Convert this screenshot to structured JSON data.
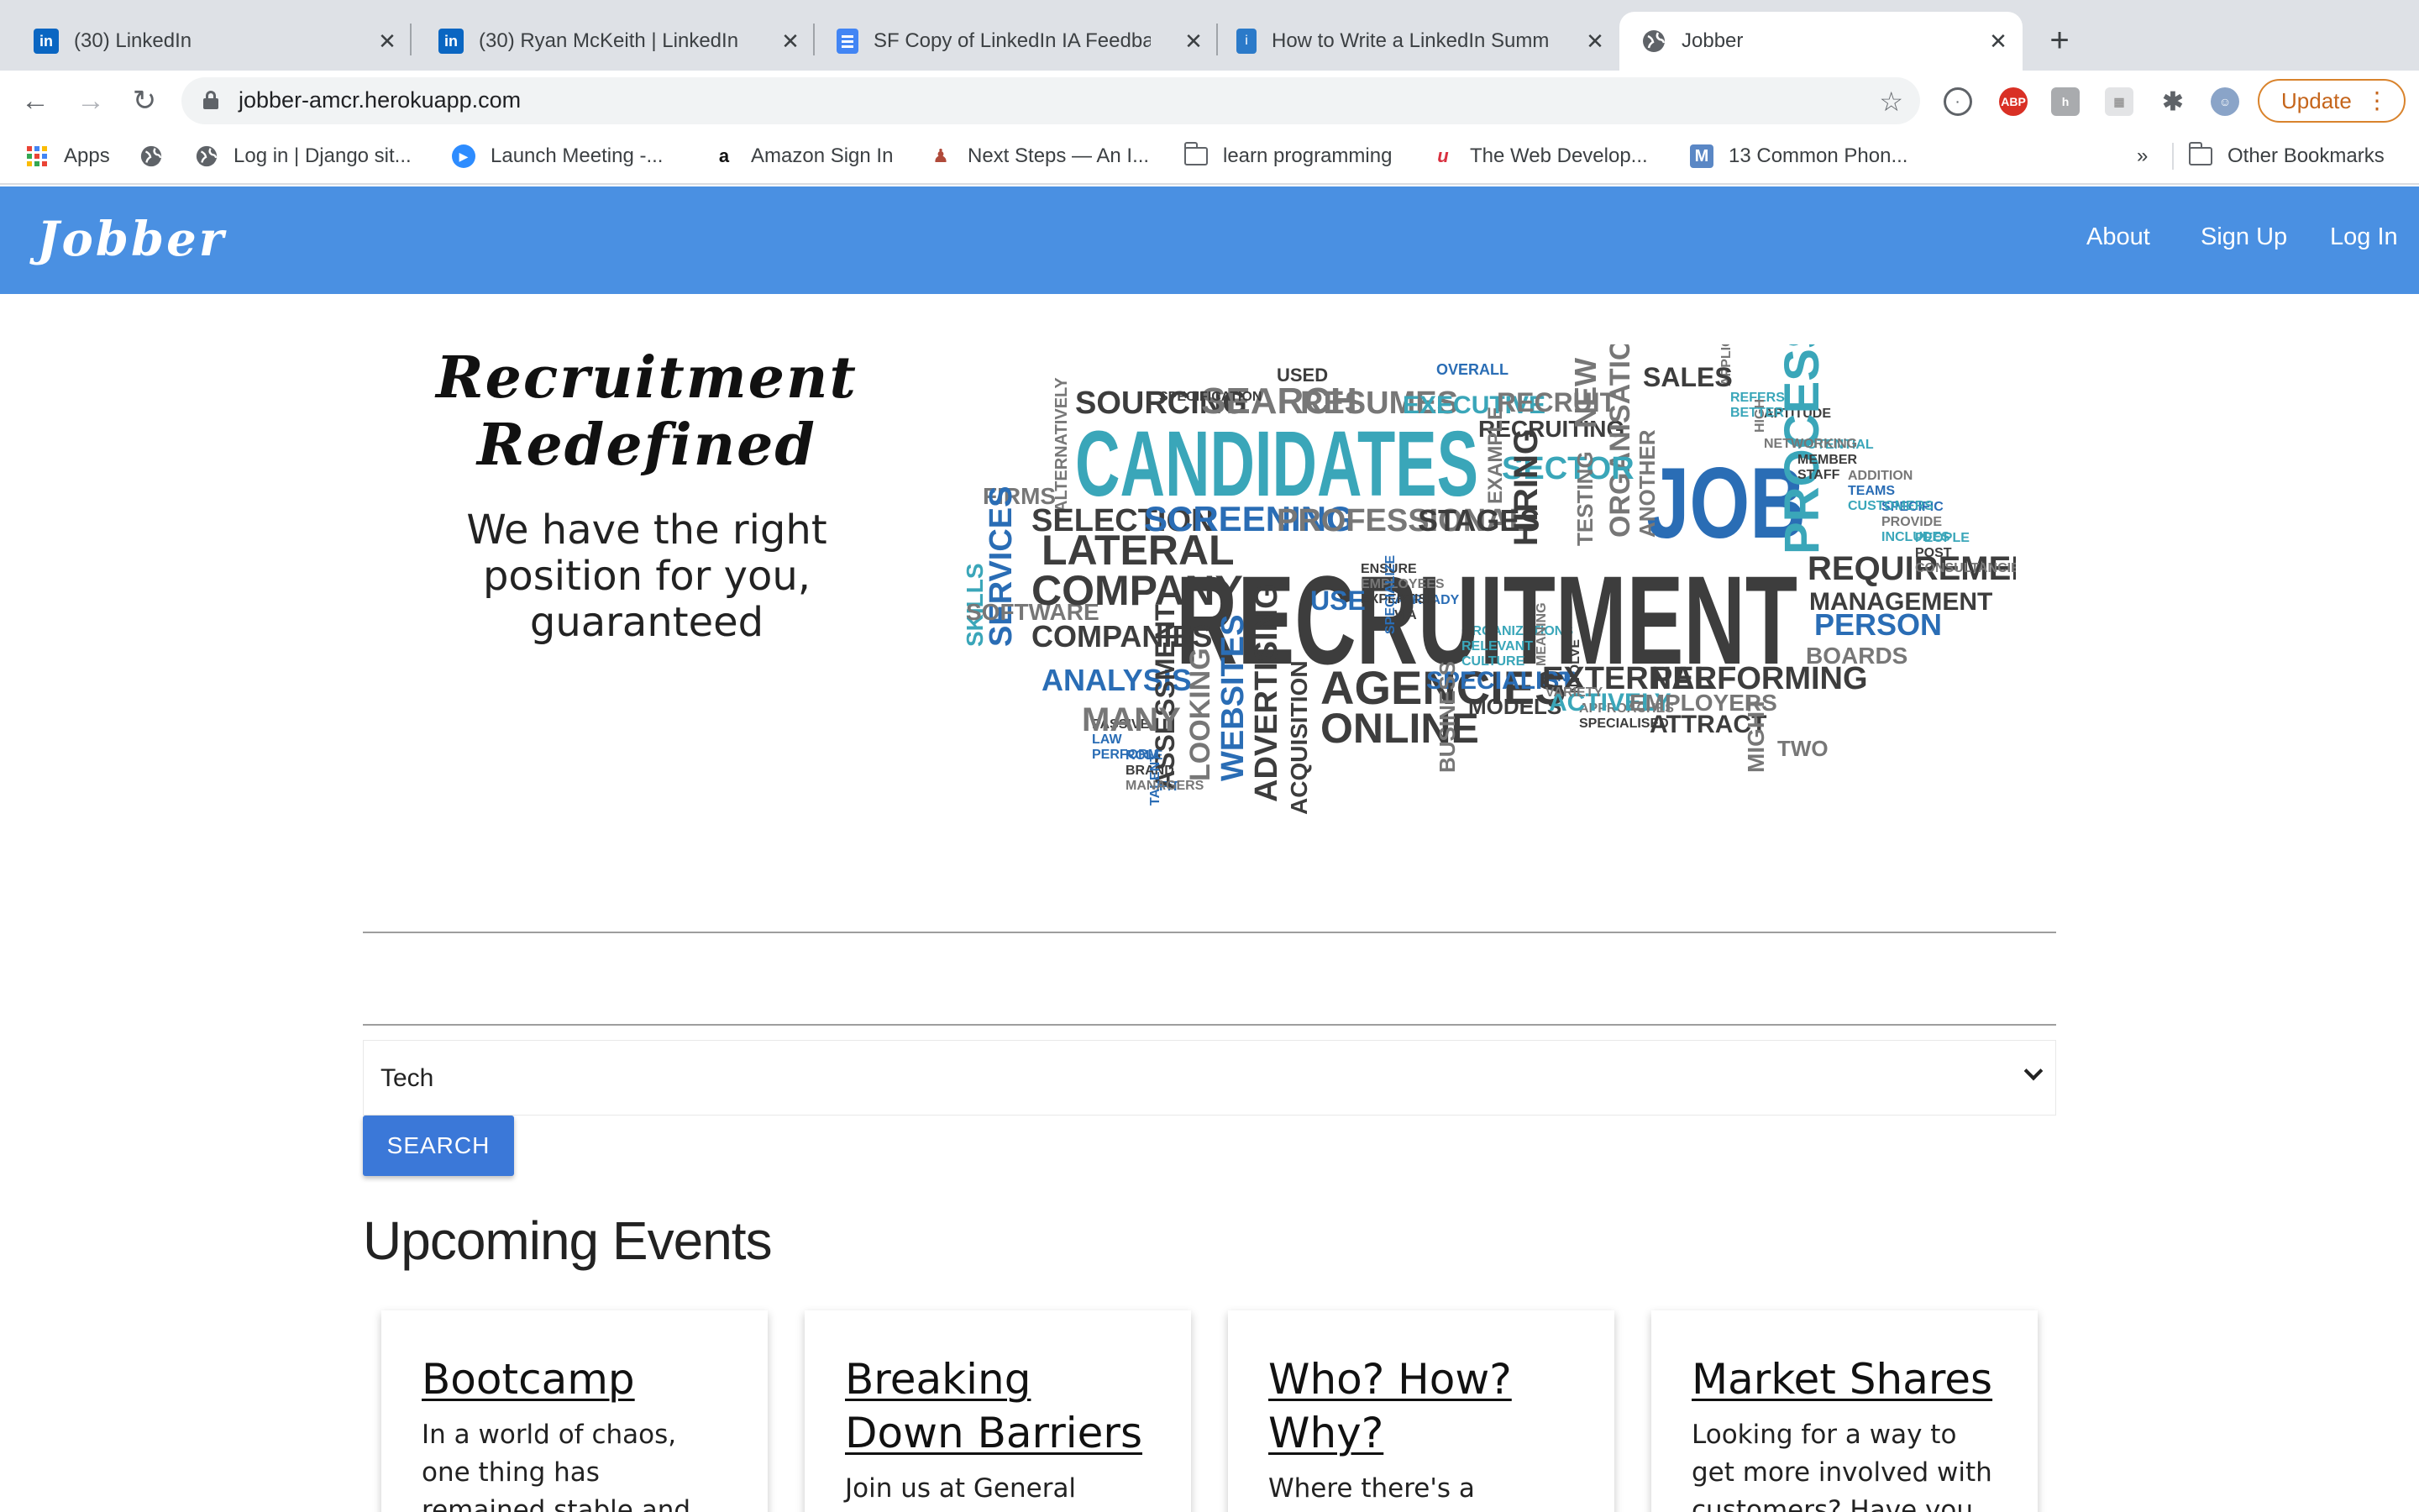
{
  "browser": {
    "tabs": [
      {
        "title": "(30) LinkedIn",
        "icon": "linkedin-icon"
      },
      {
        "title": "(30) Ryan McKeith | LinkedIn",
        "icon": "linkedin-icon"
      },
      {
        "title": "SF Copy of LinkedIn IA Feedba",
        "icon": "google-docs-icon"
      },
      {
        "title": "How to Write a LinkedIn Summ",
        "icon": "article-icon"
      },
      {
        "title": "Jobber",
        "icon": "globe-icon"
      }
    ],
    "url": "jobber-amcr.herokuapp.com",
    "update_label": "Update",
    "extensions": [
      "ABP"
    ],
    "bookmarks": [
      {
        "label": "Apps"
      },
      {
        "label": ""
      },
      {
        "label": "Log in | Django sit..."
      },
      {
        "label": "Launch Meeting -..."
      },
      {
        "label": "Amazon Sign In"
      },
      {
        "label": "Next Steps — An I..."
      },
      {
        "label": "learn programming"
      },
      {
        "label": "The Web Develop..."
      },
      {
        "label": "13 Common Phon..."
      }
    ],
    "more_bookmarks": "»",
    "other_bookmarks": "Other Bookmarks"
  },
  "site": {
    "brand": "Jobber",
    "nav": {
      "about": "About",
      "signup": "Sign Up",
      "login": "Log In"
    }
  },
  "hero": {
    "title_line1": "Recruitment",
    "title_line2": "Redefined",
    "subtitle_line1": "We have the right",
    "subtitle_line2": "position for you,",
    "subtitle_line3": "guaranteed"
  },
  "word_cloud": {
    "colors": {
      "dark": "#3d3d3d",
      "teal": "#3aa6b9",
      "blue": "#2a6db5",
      "gray": "#777777"
    },
    "words": [
      "APPLICABLE",
      "APTITUDE",
      "USED",
      "POTENTIAL",
      "ADDITION",
      "OVERALL",
      "SPECIFIC",
      "PEOPLE",
      "SOURCING",
      "SEARCH",
      "RESUMES",
      "EXECUTIVE",
      "RECRUIT",
      "RECRUITING",
      "NEW",
      "ORGANISATIONS",
      "SALES",
      "ENSURE",
      "ALREADY",
      "ORGANIZATIONS",
      "MEANING",
      "ALTERNATIVELY",
      "CANDIDATES",
      "EXAMPLE",
      "SECTOR",
      "INVOLVE",
      "JOB",
      "PROCESS",
      "FIRMS",
      "SELECTION",
      "SCREENING",
      "PROFESSIONAL",
      "STAGES",
      "PASSIVE",
      "ROLE",
      "HIRING",
      "TESTING",
      "ANOTHER",
      "FIT",
      "REFERS",
      "HIGH",
      "MEMBER",
      "TEAMS",
      "SERVICES",
      "LATERAL",
      "REQUIREMENTS",
      "SKILLS",
      "SOFTWARE",
      "COMPANY",
      "RECRUITMENT",
      "MANAGEMENT",
      "PERSON",
      "PROVIDE",
      "POST",
      "USE",
      "COMPANIES",
      "EMPLOYEES",
      "VIA",
      "BOARDS",
      "RELEVANT",
      "ANALYSIS",
      "ASSESSMENT",
      "FIND",
      "AGENCIES",
      "APPROACHES",
      "SPECIALIST",
      "LAW",
      "EXTERNAL",
      "PERFORMING",
      "BRAND",
      "TALENT",
      "BETTER",
      "NETWORKING",
      "STAFF",
      "MODELS",
      "ACTIVELY",
      "EMPLOYERS",
      "MANY",
      "LOOKING",
      "WEBSITES",
      "ADVERTISING",
      "ONLINE",
      "BUSINESS",
      "CUSTOMERS",
      "ATTRACT",
      "MIGHT",
      "TWO",
      "INCLUDES",
      "CONSULTANCIES",
      "EXPERTISE",
      "SPECIALIZE",
      "CULTURE",
      "VARIETY",
      "SPECIALISED",
      "PERFORM",
      "ACQUISITION",
      "MANAGERS",
      "SPECIFICATION"
    ]
  },
  "search": {
    "selected_category": "Tech",
    "button_label": "SEARCH"
  },
  "events": {
    "heading": "Upcoming Events",
    "cards": [
      {
        "title": "Bootcamp",
        "body": "In a world of chaos, one thing has remained stable and growing. The"
      },
      {
        "title": "Breaking Down Barriers",
        "body": "Join us at General"
      },
      {
        "title": "Who? How? Why?",
        "body": "Where there's a"
      },
      {
        "title": "Market Shares",
        "body": "Looking for a way to get more involved with customers? Have you"
      }
    ]
  }
}
